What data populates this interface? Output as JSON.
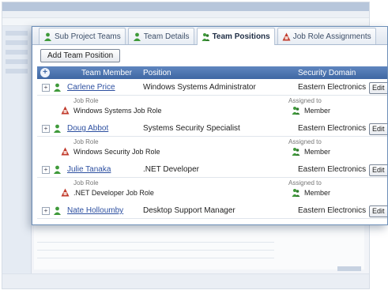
{
  "tabs": [
    {
      "label": "Sub Project Teams",
      "icon": "person-icon",
      "active": false
    },
    {
      "label": "Team Details",
      "icon": "person-icon",
      "active": false
    },
    {
      "label": "Team Positions",
      "icon": "people-icon",
      "active": true
    },
    {
      "label": "Job Role Assignments",
      "icon": "job-role-icon",
      "active": false
    }
  ],
  "toolbar": {
    "add_label": "Add Team Position"
  },
  "grid": {
    "columns": {
      "member": "Team Member",
      "position": "Position",
      "domain": "Security Domain"
    },
    "sub_headers": {
      "job_role": "Job Role",
      "assigned_to": "Assigned to"
    },
    "rows": [
      {
        "member": "Carlene Price",
        "position": "Windows Systems Administrator",
        "domain": "Eastern Electronics",
        "edit": "Edit",
        "job_role": "Windows Systems Job Role",
        "assigned": "Member"
      },
      {
        "member": "Doug Abbot",
        "position": "Systems Security Specialist",
        "domain": "Eastern Electronics",
        "edit": "Edit",
        "job_role": "Windows Security Job Role",
        "assigned": "Member"
      },
      {
        "member": "Julie Tanaka",
        "position": ".NET Developer",
        "domain": "Eastern Electronics",
        "edit": "Edit",
        "job_role": ".NET Developer Job Role",
        "assigned": "Member"
      },
      {
        "member": "Nate Holloumby",
        "position": "Desktop Support Manager",
        "domain": "Eastern Electronics",
        "edit": "Edit"
      }
    ]
  },
  "colors": {
    "header_blue": "#4a72ad",
    "accent_green": "#3f9a3a",
    "accent_red": "#c0392b",
    "link_blue": "#2c4fa0"
  }
}
